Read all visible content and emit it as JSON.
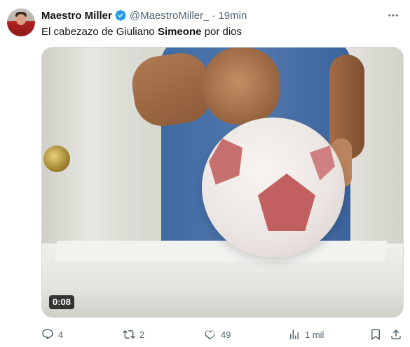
{
  "post": {
    "display_name": "Maestro Miller",
    "handle": "@MaestroMiller_",
    "separator": "·",
    "time": "19min",
    "text_before": "El cabezazo de Giuliano ",
    "text_bold": "Simeone",
    "text_after": " por dios"
  },
  "media": {
    "duration": "0:08"
  },
  "actions": {
    "replies": "4",
    "reposts": "2",
    "likes": "49",
    "views": "1 mil"
  },
  "icons": {
    "verified": "verified-badge-icon",
    "more": "more-icon",
    "reply": "reply-icon",
    "retweet": "retweet-icon",
    "like": "heart-icon",
    "views": "views-icon",
    "bookmark": "bookmark-icon",
    "share": "share-icon"
  },
  "colors": {
    "verified": "#1d9bf0",
    "secondary_text": "#536471",
    "primary_text": "#0f1419"
  }
}
